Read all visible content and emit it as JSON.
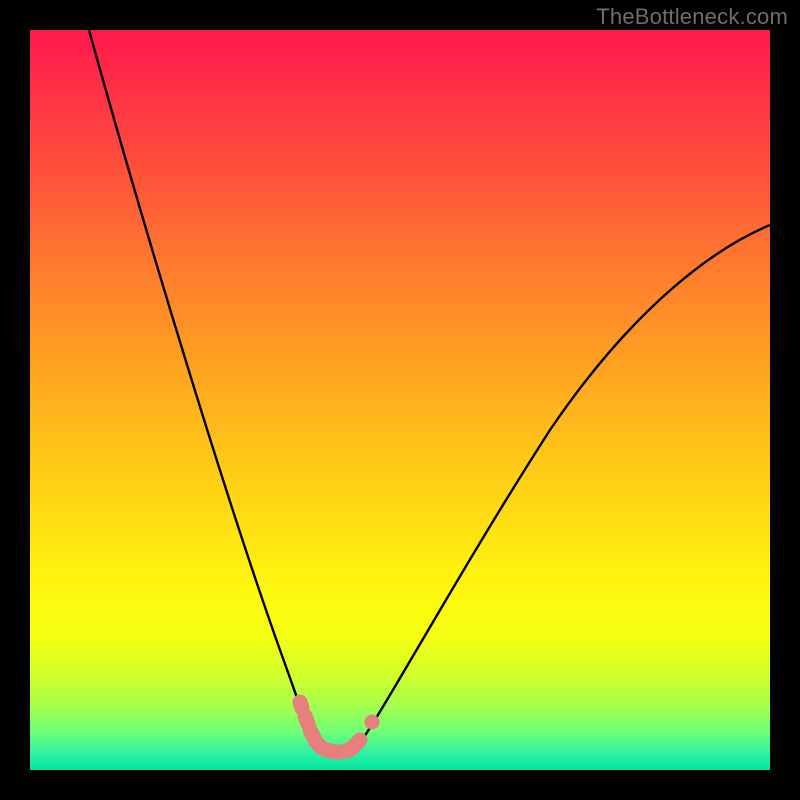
{
  "watermark": "TheBottleneck.com",
  "chart_data": {
    "type": "line",
    "title": "",
    "xlabel": "",
    "ylabel": "",
    "xlim": [
      0,
      100
    ],
    "ylim": [
      0,
      100
    ],
    "series": [
      {
        "name": "left-branch",
        "x": [
          8,
          12,
          16,
          20,
          24,
          28,
          32,
          34,
          36,
          37.5
        ],
        "values": [
          100,
          82,
          65,
          50,
          37,
          26,
          16,
          10,
          6,
          3
        ]
      },
      {
        "name": "right-branch",
        "x": [
          44,
          46,
          50,
          56,
          64,
          74,
          86,
          100
        ],
        "values": [
          3,
          6,
          12,
          22,
          35,
          49,
          62,
          73
        ]
      },
      {
        "name": "floor",
        "x": [
          37.5,
          40,
          42,
          44
        ],
        "values": [
          3,
          2.5,
          2.5,
          3
        ]
      }
    ],
    "markers": {
      "left_cluster": [
        {
          "x": 35.5,
          "y": 8
        },
        {
          "x": 36,
          "y": 6
        },
        {
          "x": 37,
          "y": 4.5
        },
        {
          "x": 38,
          "y": 3.2
        },
        {
          "x": 39,
          "y": 2.8
        },
        {
          "x": 40,
          "y": 2.6
        },
        {
          "x": 41,
          "y": 2.6
        },
        {
          "x": 42,
          "y": 2.8
        },
        {
          "x": 43,
          "y": 3.2
        },
        {
          "x": 44,
          "y": 4
        }
      ],
      "right_cluster": [
        {
          "x": 45.5,
          "y": 6.5
        }
      ]
    },
    "colors": {
      "curve": "#000000",
      "marker": "#e77f7d"
    }
  }
}
